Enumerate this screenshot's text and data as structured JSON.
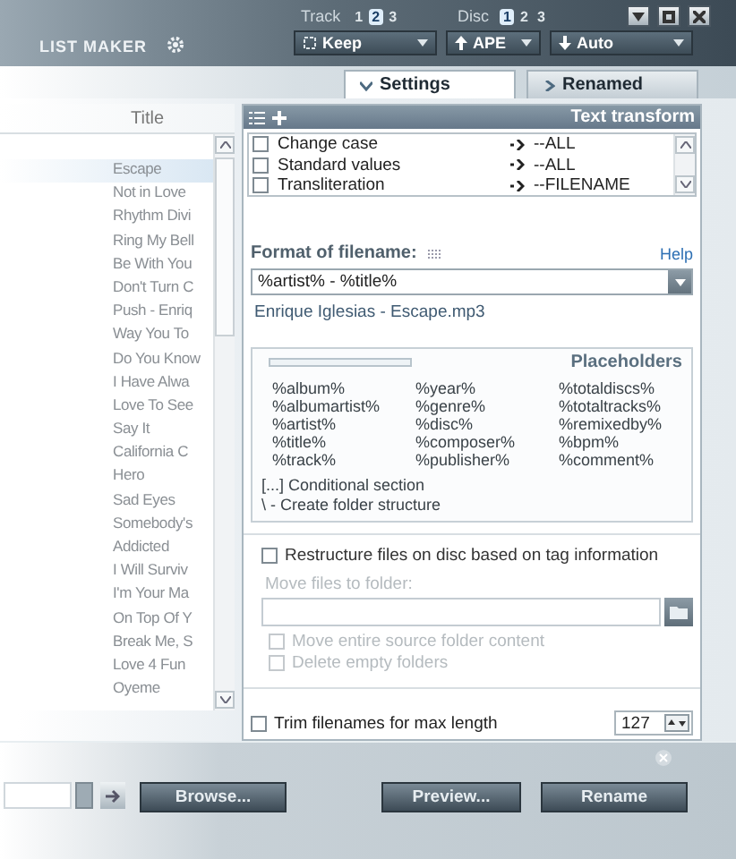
{
  "header": {
    "app_title": "LIST MAKER",
    "selectors": [
      {
        "label": "Track",
        "options": [
          {
            "label": "1",
            "selected": false
          },
          {
            "label": "2",
            "selected": true
          },
          {
            "label": "3",
            "selected": false
          }
        ]
      },
      {
        "label": "Disc",
        "options": [
          {
            "label": "1",
            "selected": true
          },
          {
            "label": "2",
            "selected": false
          },
          {
            "label": "3",
            "selected": false
          }
        ]
      }
    ],
    "dropdowns": [
      {
        "label": "Keep",
        "kind": "keep"
      },
      {
        "label": "APE",
        "kind": "up"
      },
      {
        "label": "Auto",
        "kind": "down"
      }
    ]
  },
  "tabs": [
    {
      "label": "Settings",
      "selected": true
    },
    {
      "label": "Renamed",
      "selected": false
    }
  ],
  "list": {
    "column": "Title",
    "rows": [
      {
        "title": "Escape",
        "selected": true
      },
      {
        "title": "Not in Love",
        "selected": false
      },
      {
        "title": "Rhythm Divi",
        "selected": false
      },
      {
        "title": "Ring My Bell",
        "selected": false
      },
      {
        "title": "Be With You",
        "selected": false
      },
      {
        "title": "Don't Turn C",
        "selected": false
      },
      {
        "title": "Push - Enriq",
        "selected": false
      },
      {
        "title": "Way You To",
        "selected": false
      },
      {
        "title": "Do You Know",
        "selected": false
      },
      {
        "title": "I Have Alwa",
        "selected": false
      },
      {
        "title": "Love To See",
        "selected": false
      },
      {
        "title": "Say It",
        "selected": false
      },
      {
        "title": "California C",
        "selected": false
      },
      {
        "title": "Hero",
        "selected": false
      },
      {
        "title": "Sad Eyes",
        "selected": false
      },
      {
        "title": "Somebody's",
        "selected": false
      },
      {
        "title": "Addicted",
        "selected": false
      },
      {
        "title": "I Will Surviv",
        "selected": false
      },
      {
        "title": "I'm Your Ma",
        "selected": false
      },
      {
        "title": "On Top Of Y",
        "selected": false
      },
      {
        "title": "Break Me, S",
        "selected": false
      },
      {
        "title": "Love 4 Fun",
        "selected": false
      },
      {
        "title": "Oyeme",
        "selected": false
      }
    ]
  },
  "text_transform": {
    "title": "Text transform",
    "rows": [
      {
        "name": "Change case",
        "checked": false,
        "value": "--ALL"
      },
      {
        "name": "Standard values",
        "checked": false,
        "value": "--ALL"
      },
      {
        "name": "Transliteration",
        "checked": false,
        "value": "--FILENAME"
      }
    ]
  },
  "format": {
    "label": "Format of filename:",
    "help": "Help",
    "value": "%artist% - %title%",
    "preview": "Enrique Iglesias - Escape.mp3"
  },
  "placeholders": {
    "title": "Placeholders",
    "items": [
      "%album%",
      "%albumartist%",
      "%artist%",
      "%title%",
      "%track%",
      "%year%",
      "%genre%",
      "%disc%",
      "%composer%",
      "%publisher%",
      "%totaldiscs%",
      "%totaltracks%",
      "%remixedby%",
      "%bpm%",
      "%comment%"
    ],
    "notes": [
      "[...] Conditional section",
      "\\ - Create folder structure"
    ]
  },
  "restructure": {
    "label": "Restructure files on disc based on tag information",
    "checked": false,
    "move_label": "Move files to folder:",
    "options": [
      {
        "label": "Move entire source folder content",
        "checked": false,
        "disabled": true
      },
      {
        "label": "Delete empty folders",
        "checked": false,
        "disabled": true
      }
    ]
  },
  "trim": {
    "label": "Trim filenames for max length",
    "checked": false,
    "value": "127"
  },
  "buttons": [
    {
      "label": "Browse..."
    },
    {
      "label": "Preview..."
    },
    {
      "label": "Rename"
    }
  ]
}
